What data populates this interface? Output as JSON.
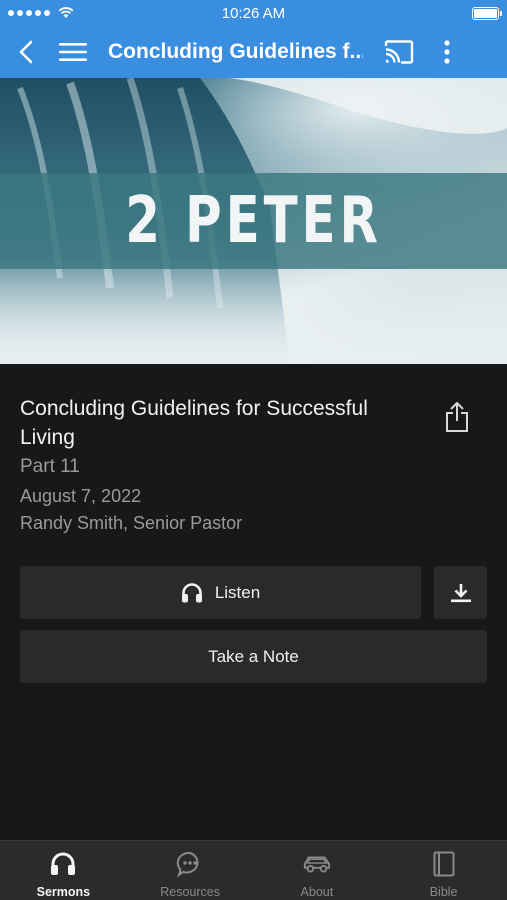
{
  "status_bar": {
    "time": "10:26 AM"
  },
  "app_bar": {
    "title": "Concluding Guidelines f..."
  },
  "hero": {
    "title": "2 PETER"
  },
  "sermon": {
    "title": "Concluding Guidelines for Successful Living",
    "part": "Part 11",
    "date": "August 7, 2022",
    "speaker": "Randy Smith, Senior Pastor"
  },
  "actions": {
    "listen_label": "Listen",
    "note_label": "Take a Note"
  },
  "tabs": [
    {
      "label": "Sermons",
      "icon": "headphones-icon",
      "active": true
    },
    {
      "label": "Resources",
      "icon": "chat-bubble-icon",
      "active": false
    },
    {
      "label": "About",
      "icon": "car-icon",
      "active": false
    },
    {
      "label": "Bible",
      "icon": "book-icon",
      "active": false
    }
  ],
  "colors": {
    "app_bar": "#3a8ee0",
    "background": "#17181a",
    "button": "#2a2a2b",
    "secondary_text": "#9a9a9a"
  }
}
